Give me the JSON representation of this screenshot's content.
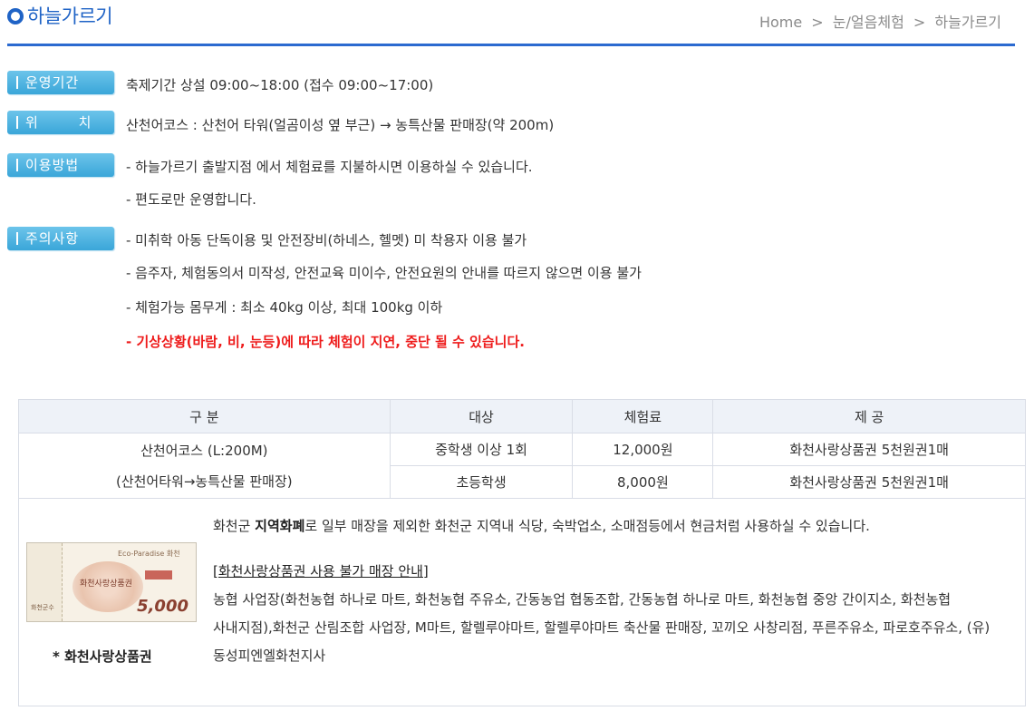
{
  "header": {
    "title": "하늘가르기",
    "breadcrumb": [
      "Home",
      "눈/얼음체험",
      "하늘가르기"
    ],
    "separator": ">"
  },
  "info": {
    "period": {
      "label": "운영기간",
      "lines": [
        "축제기간 상설 09:00~18:00 (접수 09:00~17:00)"
      ]
    },
    "location": {
      "label": "위 치",
      "lines": [
        "산천어코스 : 산천어 타워(얼곰이성 옆 부근) → 농특산물 판매장(약 200m)"
      ]
    },
    "usage": {
      "label": "이용방법",
      "lines": [
        "- 하늘가르기 출발지점 에서 체험료를 지불하시면 이용하실 수 있습니다.",
        "- 편도로만 운영합니다."
      ]
    },
    "caution": {
      "label": "주의사항",
      "lines": [
        "- 미취학 아동 단독이용 및 안전장비(하네스, 헬멧) 미 착용자 이용 불가",
        "- 음주자, 체험동의서 미작성, 안전교육 미이수, 안전요원의 안내를 따르지 않으면 이용 불가",
        "- 체험가능 몸무게 : 최소 40kg 이상, 최대 100kg 이하"
      ],
      "warning": "- 기상상황(바람, 비, 눈등)에 따라 체험이 지연, 중단 될 수 있습니다."
    }
  },
  "fee_table": {
    "headers": [
      "구 분",
      "대상",
      "체험료",
      "제 공"
    ],
    "course_line1": "산천어코스 (L:200M)",
    "course_line2": "(산천어타워→농특산물 판매장)",
    "rows": [
      {
        "target": "중학생 이상 1회",
        "fee": "12,000원",
        "provide": "화천사랑상품권 5천원권1매"
      },
      {
        "target": "초등학생",
        "fee": "8,000원",
        "provide": "화천사랑상품권 5천원권1매"
      }
    ]
  },
  "voucher": {
    "caption": "* 화천사랑상품권",
    "image_name": "화천사랑상품권",
    "image_amount": "5,000",
    "image_top": "Eco-Paradise 화천",
    "image_stub": "화천군수",
    "intro_prefix": "화천군 ",
    "intro_bold": "지역화폐",
    "intro_rest": "로 일부 매장을 제외한 화천군 지역내 식당, 숙박업소, 소매점등에서 현금처럼 사용하실 수 있습니다.",
    "notice_title": "[화천사랑상품권 사용 불가 매장 안내]",
    "stores": "농협 사업장(화천농협 하나로 마트, 화천농협 주유소, 간동농업 협동조합, 간동농협 하나로 마트, 화천농협 중앙 간이지소, 화천농협 사내지점),화천군 산림조합 사업장, M마트, 할렐루야마트, 할렐루야마트 축산물 판매장, 꼬끼오 사창리점, 푸른주유소, 파로호주유소, (유)동성피엔엘화천지사"
  }
}
